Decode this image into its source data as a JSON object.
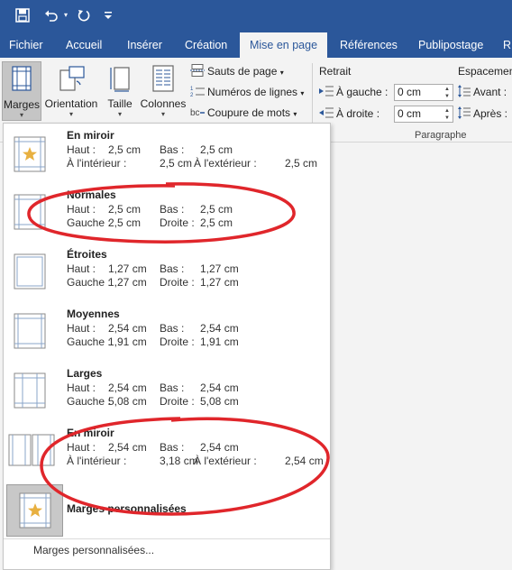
{
  "quick_access": {
    "save_icon": "save-icon",
    "undo_icon": "undo-icon",
    "redo_icon": "redo-icon",
    "customize_icon": "customize-qat-icon"
  },
  "tabs": [
    {
      "label": "Fichier"
    },
    {
      "label": "Accueil"
    },
    {
      "label": "Insérer"
    },
    {
      "label": "Création"
    },
    {
      "label": "Mise en page",
      "active": true
    },
    {
      "label": "Références"
    },
    {
      "label": "Publipostage"
    },
    {
      "label": "R"
    }
  ],
  "ribbon": {
    "marges": "Marges",
    "orientation": "Orientation",
    "taille": "Taille",
    "colonnes": "Colonnes",
    "sauts": "Sauts de page",
    "numeros": "Numéros de lignes",
    "coupure": "Coupure de mots",
    "retrait": {
      "title": "Retrait",
      "gauche_label": "À gauche :",
      "gauche_value": "0 cm",
      "droite_label": "À droite :",
      "droite_value": "0 cm"
    },
    "espacement": {
      "title": "Espacement",
      "avant_label": "Avant :",
      "apres_label": "Après :"
    },
    "group_paragraphe": "Paragraphe"
  },
  "margin_presets": [
    {
      "name": "En miroir",
      "r1": {
        "l1": "Haut :",
        "v1": "2,5 cm",
        "l2": "Bas :",
        "v2": "2,5 cm"
      },
      "r2": {
        "l1": "À l'intérieur :",
        "v1": "2,5 cm",
        "l2": "À l'extérieur :",
        "v2": "2,5 cm"
      }
    },
    {
      "name": "Normales",
      "r1": {
        "l1": "Haut :",
        "v1": "2,5 cm",
        "l2": "Bas :",
        "v2": "2,5 cm"
      },
      "r2": {
        "l1": "Gauche :",
        "v1": "2,5 cm",
        "l2": "Droite :",
        "v2": "2,5 cm"
      }
    },
    {
      "name": "Étroites",
      "r1": {
        "l1": "Haut :",
        "v1": "1,27 cm",
        "l2": "Bas :",
        "v2": "1,27 cm"
      },
      "r2": {
        "l1": "Gauche :",
        "v1": "1,27 cm",
        "l2": "Droite :",
        "v2": "1,27 cm"
      }
    },
    {
      "name": "Moyennes",
      "r1": {
        "l1": "Haut :",
        "v1": "2,54 cm",
        "l2": "Bas :",
        "v2": "2,54 cm"
      },
      "r2": {
        "l1": "Gauche :",
        "v1": "1,91 cm",
        "l2": "Droite :",
        "v2": "1,91 cm"
      }
    },
    {
      "name": "Larges",
      "r1": {
        "l1": "Haut :",
        "v1": "2,54 cm",
        "l2": "Bas :",
        "v2": "2,54 cm"
      },
      "r2": {
        "l1": "Gauche :",
        "v1": "5,08 cm",
        "l2": "Droite :",
        "v2": "5,08 cm"
      }
    },
    {
      "name": "En miroir",
      "r1": {
        "l1": "Haut :",
        "v1": "2,54 cm",
        "l2": "Bas :",
        "v2": "2,54 cm"
      },
      "r2": {
        "l1": "À l'intérieur :",
        "v1": "3,18 cm",
        "l2": "À l'extérieur :",
        "v2": "2,54 cm"
      }
    }
  ],
  "custom_preset": {
    "name": "Marges personnalisées"
  },
  "footer_link": "Marges personnalisées...",
  "colors": {
    "brand": "#2b579a",
    "annotation": "#e0262b",
    "star": "#e8b040"
  }
}
